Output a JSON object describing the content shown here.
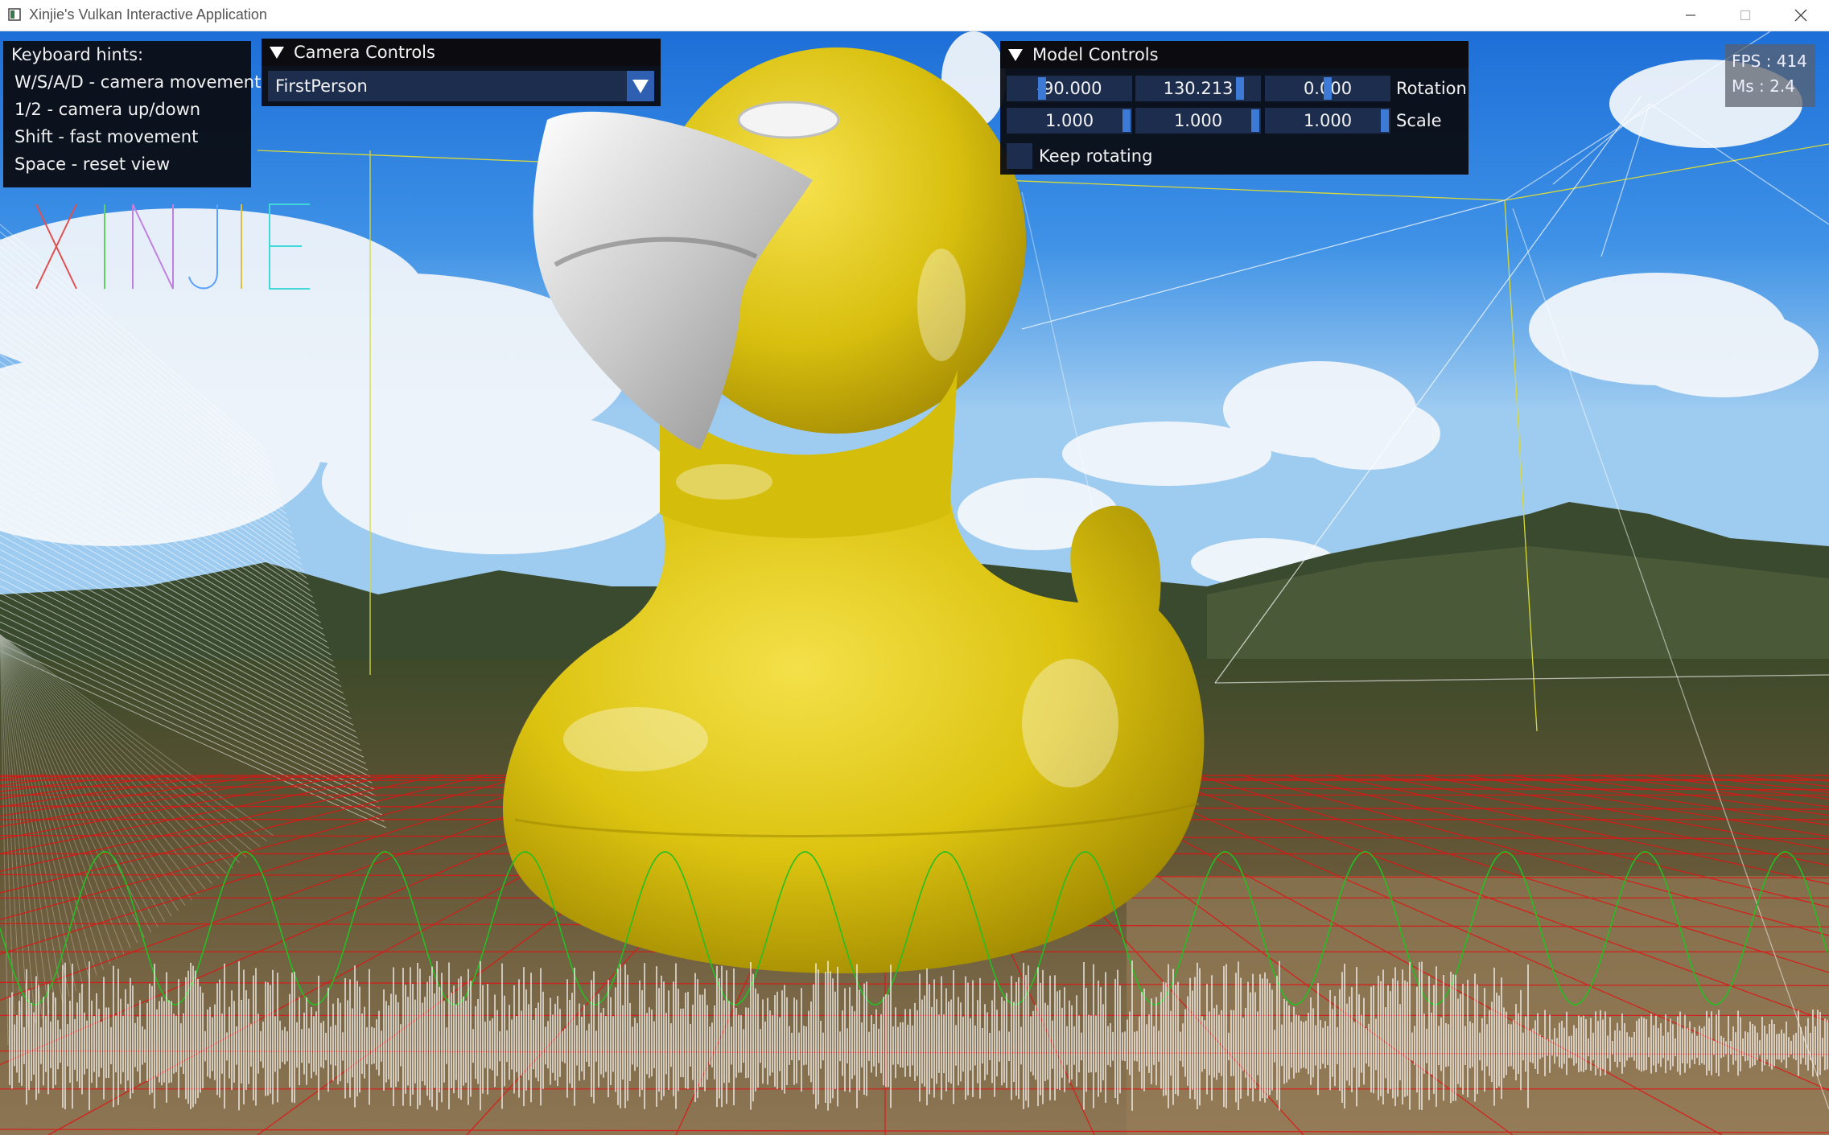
{
  "window": {
    "title": "Xinjie's Vulkan Interactive Application"
  },
  "hints": {
    "header": "Keyboard hints:",
    "lines": [
      "W/S/A/D - camera movement",
      "1/2 - camera up/down",
      "Shift - fast movement",
      "Space - reset view"
    ]
  },
  "camera_controls": {
    "header": "Camera Controls",
    "selected_mode": "FirstPerson"
  },
  "model_controls": {
    "header": "Model Controls",
    "rotation_label": "Rotation",
    "rotation": [
      -90.0,
      130.213,
      0.0
    ],
    "rotation_text": [
      "-90.000",
      "130.213",
      "0.000"
    ],
    "scale_label": "Scale",
    "scale": [
      1.0,
      1.0,
      1.0
    ],
    "scale_text": [
      "1.000",
      "1.000",
      "1.000"
    ],
    "keep_rotating_label": "Keep rotating",
    "keep_rotating_checked": false
  },
  "stats": {
    "fps_text": "FPS : 414",
    "ms_text": "Ms  : 2.4"
  },
  "watermark": "XINJIE",
  "colors": {
    "panel_bg": "#0a0c12",
    "widget_bg": "#1d2d4e",
    "widget_grab": "#3d7ad6",
    "duck_yellow": "#e6cc0a",
    "grid_red": "#e01515",
    "sine_green": "#22c022",
    "bbox_yellow": "#d8d83a"
  }
}
